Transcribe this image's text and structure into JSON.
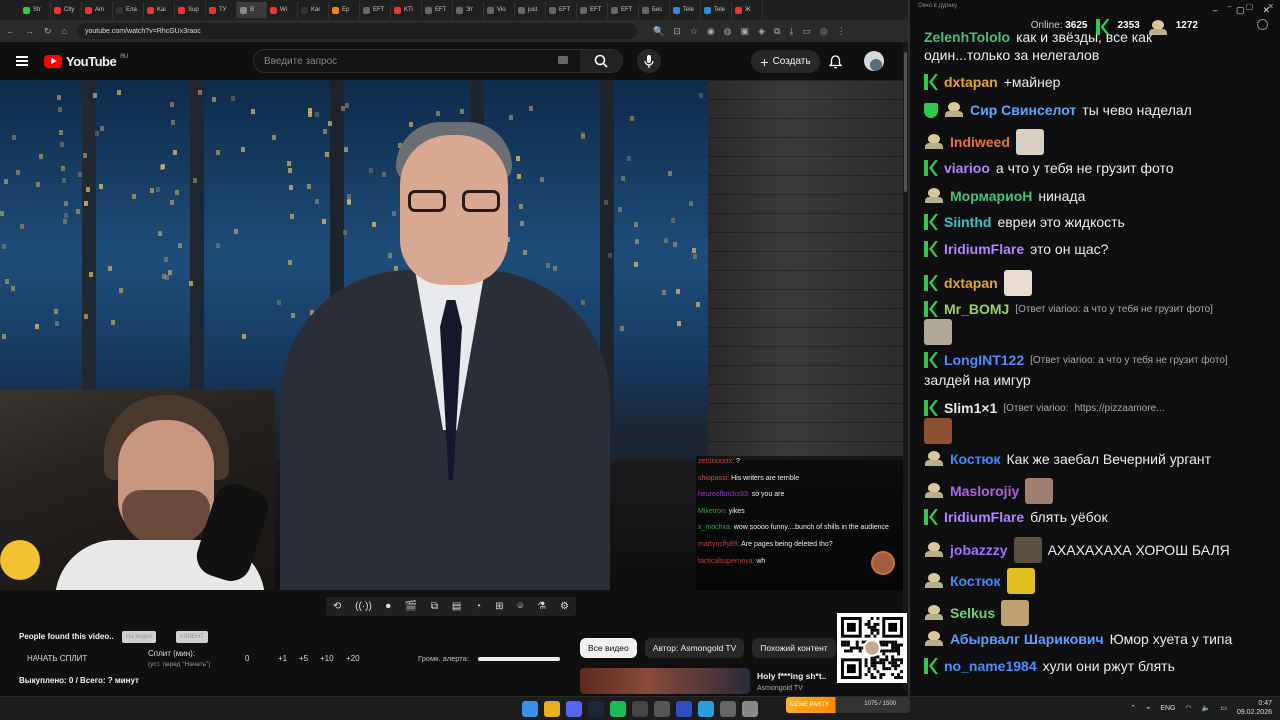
{
  "browser": {
    "tabs": [
      "Str",
      "City",
      "Am",
      "Ела",
      "Kai",
      "Sup",
      "ТУ",
      "B",
      "Wi",
      "Kar",
      "Ep",
      "EFT",
      "KTi",
      "EFT",
      "Эт",
      "Vio",
      "just",
      "EFT",
      "EFT",
      "EFT",
      "Бес",
      "Tele",
      "Tele",
      "Ж"
    ],
    "url": "youtube.com/watch?v=RhcGUx3raoc"
  },
  "youtube": {
    "region": "RU",
    "logo": "YouTube",
    "search_placeholder": "Введите запрос",
    "create_label": "Создать"
  },
  "overlay_chat": [
    {
      "user": "zetoxxxxxx:",
      "text": "?",
      "color": "#d04040"
    },
    {
      "user": "shiopassi:",
      "text": "His writers are terrible",
      "color": "#c05050"
    },
    {
      "user": "heureofbricks93:",
      "text": "so you are",
      "color": "#9040c0"
    },
    {
      "user": "Miketron:",
      "text": "yikes",
      "color": "#3aa040"
    },
    {
      "user": "x_mochxa:",
      "text": "wow soooo funny....bunch of shills in the audience",
      "color": "#3aa040"
    },
    {
      "user": "martyncfly89:",
      "text": "Are pages being deleted tho?",
      "color": "#c04040"
    },
    {
      "user": "tacticalsupernova:",
      "text": "wh",
      "color": "#c04040"
    }
  ],
  "panel": {
    "found_label": "People found this video..",
    "chip1": "На видео",
    "chip2": "КЛИЕНТ",
    "start_split": "НАЧАТЬ СПЛИТ",
    "split_label": "Сплит (мин):",
    "split_hint": "(уст. перед \"Начать\")",
    "split_values": [
      "0",
      "+1",
      "+5",
      "+10",
      "+20"
    ],
    "volume_label": "Громк. алерта:",
    "bought": "Выкуплено: 0 / Всего: ? минут"
  },
  "related": {
    "filters": [
      "Все видео",
      "Автор: Asmongold TV",
      "Похожий контент"
    ],
    "video_title": "Holy f***ing sh*t..",
    "video_channel": "Asmongold TV"
  },
  "meme_bar": {
    "label": "MEME PARTY",
    "progress": "1075 / 1500"
  },
  "tray": {
    "lang": "ENG",
    "time": "0:47",
    "date": "09.02.2026"
  },
  "chat": {
    "title": "Окно в дураку",
    "online_label": "Online:",
    "online": "3625",
    "k_count": "2353",
    "p_count": "1272",
    "top_line": "как и звёзды, все как",
    "top_user": "ZelenhTololo",
    "top_line2": "один...только за нелегалов",
    "messages": [
      {
        "badge": "k",
        "user": "dxtapan",
        "color": "#e8a330",
        "text": "+майнер"
      },
      {
        "badge": "shield",
        "user": "Сир Свинселот",
        "color": "#56a9ff",
        "text": "ты чево наделал"
      },
      {
        "badge": "p",
        "user": "Indiweed",
        "color": "#e8733a",
        "text": "",
        "emote": "#d9d0c4"
      },
      {
        "badge": "k",
        "user": "viarioo",
        "color": "#b384ff",
        "text": "а что у тебя не грузит фото"
      },
      {
        "badge": "p",
        "user": "МормариоН",
        "color": "#48c07a",
        "text": "нинада"
      },
      {
        "badge": "k",
        "user": "Siinthd",
        "color": "#33c6c6",
        "text": "евреи это жидкость"
      },
      {
        "badge": "k",
        "user": "IridiumFlare",
        "color": "#b384ff",
        "text": "это он щас?"
      },
      {
        "badge": "k",
        "user": "dxtapan",
        "color": "#e8a330",
        "text": "",
        "emote": "#e8dcd0"
      },
      {
        "badge": "k",
        "user": "Mr_BOMJ",
        "color": "#9ad35e",
        "reply": "[Ответ viarioo: а что у тебя не грузит фото]"
      },
      {
        "badge": "k",
        "user": "LongINT122",
        "color": "#4a8fff",
        "reply": "[Ответ viarioo: а что у тебя не грузит фото]",
        "line2": "залдей на имгур"
      },
      {
        "badge": "k",
        "user": "Slim1×1",
        "color": "#e6e6e6",
        "reply": "[Ответ viarioo:",
        "link": "https://pizzaamore..."
      },
      {
        "badge": "p",
        "user": "Костюк",
        "color": "#3a8bff",
        "text": "Как же заебал Вечерний ургант"
      },
      {
        "badge": "p",
        "user": "Maslorojiy",
        "color": "#b060e0",
        "text": "",
        "emote": "#a08070"
      },
      {
        "badge": "k",
        "user": "IridiumFlare",
        "color": "#b384ff",
        "text": "блять уёбок"
      },
      {
        "badge": "p",
        "user": "jobazzzy",
        "color": "#a070ff",
        "text": "АХАХАХАХА ХОРОШ БАЛЯ",
        "emote": "#5a5040"
      },
      {
        "badge": "p",
        "user": "Костюк",
        "color": "#3a8bff",
        "text": "",
        "emote": "#e0c020"
      },
      {
        "badge": "p",
        "user": "Selkus",
        "color": "#6fd06f",
        "text": "",
        "emote": "#c0a070"
      },
      {
        "badge": "p",
        "user": "Абырвалг Шарикович",
        "color": "#5aa0ff",
        "text": "Юмор хуета у типа"
      },
      {
        "badge": "k",
        "user": "no_name1984",
        "color": "#4a8fff",
        "text": "хули они ржут блять"
      }
    ]
  }
}
